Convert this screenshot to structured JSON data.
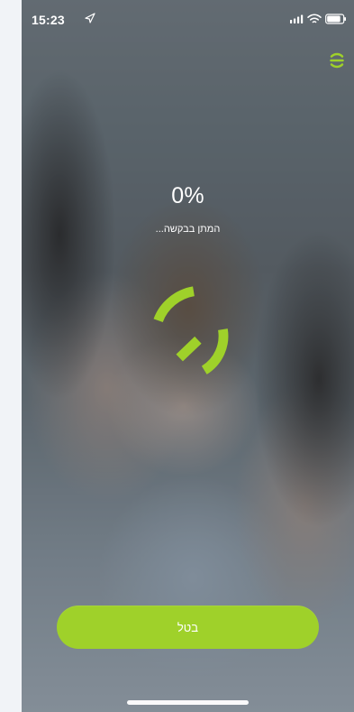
{
  "status_bar": {
    "time": "15:23",
    "location_icon": "location-arrow-icon",
    "signal_icon": "cellular-signal-icon",
    "wifi_icon": "wifi-icon",
    "battery_icon": "battery-icon"
  },
  "header": {
    "menu_icon": "menu-icon"
  },
  "progress": {
    "percent": "0%",
    "value": 0,
    "status_text": "המתן בבקשה..."
  },
  "actions": {
    "cancel_label": "בטל"
  },
  "colors": {
    "accent": "#9fd12a",
    "text": "#ffffff"
  }
}
